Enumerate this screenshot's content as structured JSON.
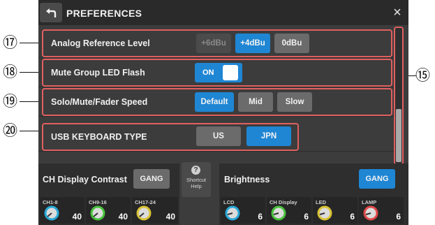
{
  "header": {
    "title": "PREFERENCES",
    "back_icon": "back-arrow-icon",
    "close_label": "×"
  },
  "rows": {
    "analog_ref": {
      "label": "Analog Reference Level",
      "options": [
        "+6dBu",
        "+4dBu",
        "0dBu"
      ],
      "selected": "+4dBu",
      "disabled": "+6dBu"
    },
    "mute_led": {
      "label": "Mute Group LED Flash",
      "toggle_label": "ON",
      "value": true
    },
    "speed": {
      "label": "Solo/Mute/Fader Speed",
      "options": [
        "Default",
        "Mid",
        "Slow"
      ],
      "selected": "Default"
    },
    "usb_kb": {
      "label": "USB KEYBOARD TYPE",
      "options": [
        "US",
        "JPN"
      ],
      "selected": "JPN"
    }
  },
  "contrast": {
    "title": "CH Display Contrast",
    "gang_label": "GANG",
    "knobs": [
      {
        "label": "CH1-8",
        "value": "40",
        "color": "#27a9d8"
      },
      {
        "label": "CH9-16",
        "value": "40",
        "color": "#48c23c"
      },
      {
        "label": "CH17-24",
        "value": "40",
        "color": "#d9c233"
      }
    ]
  },
  "help": {
    "icon": "question-icon",
    "line1": "Shortcut",
    "line2": "Help"
  },
  "brightness": {
    "title": "Brightness",
    "gang_label": "GANG",
    "knobs": [
      {
        "label": "LCD",
        "value": "6",
        "color": "#27a9d8"
      },
      {
        "label": "CH Display",
        "value": "6",
        "color": "#48c23c"
      },
      {
        "label": "LED",
        "value": "6",
        "color": "#d9c233"
      },
      {
        "label": "LAMP",
        "value": "6",
        "color": "#e04848"
      }
    ]
  },
  "callouts": {
    "c17": "⑰",
    "c18": "⑱",
    "c19": "⑲",
    "c20": "⑳",
    "c15": "⑮"
  },
  "colors": {
    "accent": "#1f86d4",
    "annotation": "#e06060"
  }
}
